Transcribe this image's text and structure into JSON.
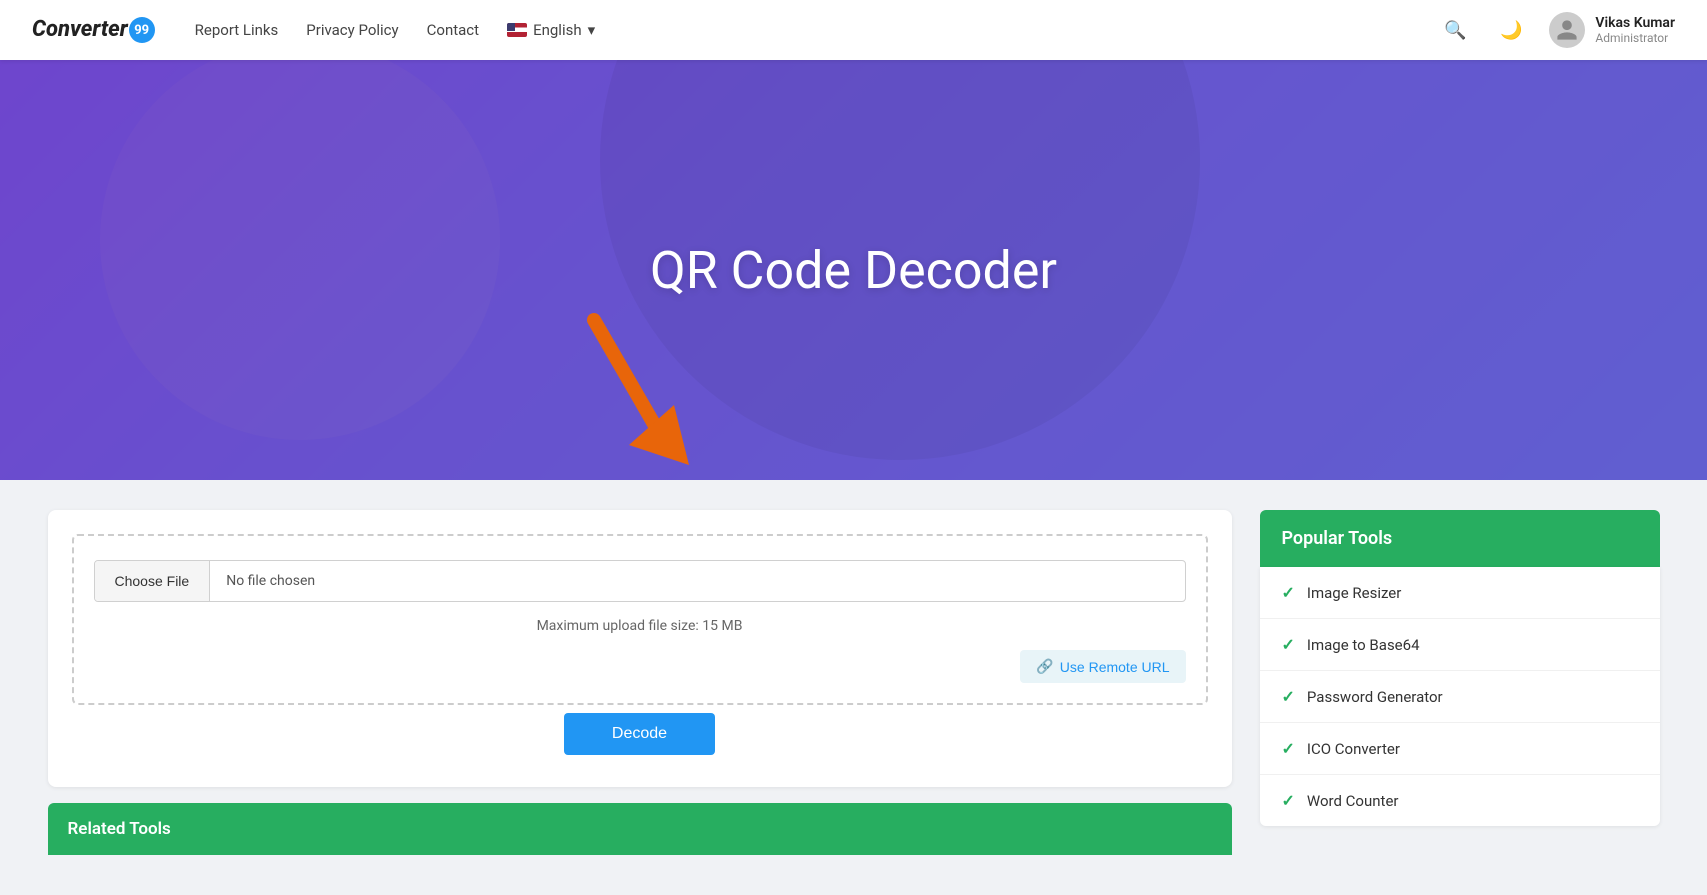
{
  "brand": {
    "name": "Converter",
    "badge": "99"
  },
  "navbar": {
    "links": [
      {
        "id": "report-links",
        "label": "Report Links"
      },
      {
        "id": "privacy-policy",
        "label": "Privacy Policy"
      },
      {
        "id": "contact",
        "label": "Contact"
      }
    ],
    "language": {
      "label": "English",
      "flag": "us"
    },
    "user": {
      "name": "Vikas Kumar",
      "role": "Administrator"
    }
  },
  "hero": {
    "title": "QR Code Decoder"
  },
  "tool": {
    "choose_file_label": "Choose File",
    "no_file_label": "No file chosen",
    "max_size_label": "Maximum upload file size: 15 MB",
    "remote_url_label": "Use Remote URL",
    "decode_button_label": "Decode"
  },
  "related_tools": {
    "header": "Related Tools"
  },
  "sidebar": {
    "popular_tools_header": "Popular Tools",
    "items": [
      {
        "id": "image-resizer",
        "label": "Image Resizer"
      },
      {
        "id": "image-to-base64",
        "label": "Image to Base64"
      },
      {
        "id": "password-generator",
        "label": "Password Generator"
      },
      {
        "id": "ico-converter",
        "label": "ICO Converter"
      },
      {
        "id": "word-counter",
        "label": "Word Counter"
      }
    ]
  },
  "icons": {
    "search": "🔍",
    "moon": "🌙",
    "check": "✓",
    "link": "🔗",
    "chevron_down": "▾"
  }
}
